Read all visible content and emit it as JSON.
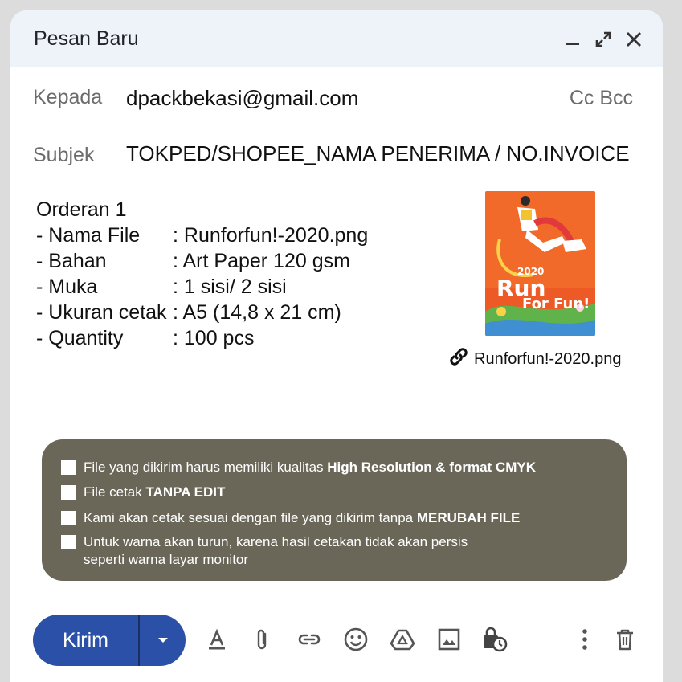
{
  "window": {
    "title": "Pesan Baru"
  },
  "to": {
    "label": "Kepada",
    "value": "dpackbekasi@gmail.com",
    "cc_bcc": "Cc Bcc"
  },
  "subject": {
    "label": "Subjek",
    "value": "TOKPED/SHOPEE_NAMA PENERIMA / NO.INVOICE"
  },
  "body": {
    "heading": "Orderan 1",
    "rows": [
      {
        "label": "- Nama File",
        "value": ": Runforfun!-2020.png"
      },
      {
        "label": "- Bahan",
        "value": ": Art Paper 120 gsm"
      },
      {
        "label": "- Muka",
        "value": ": 1 sisi/ 2 sisi"
      },
      {
        "label": "- Ukuran cetak",
        "value": ": A5 (14,8 x 21 cm)"
      },
      {
        "label": "- Quantity",
        "value": ": 100 pcs"
      }
    ]
  },
  "attachment": {
    "filename": "Runforfun!-2020.png",
    "thumb_year": "2020",
    "thumb_title_1": "Run",
    "thumb_title_2": "For Fun!"
  },
  "notice": {
    "items": [
      {
        "text": "File yang dikirim harus memiliki kualitas ",
        "bold": "High Resolution & format CMYK"
      },
      {
        "text": "File cetak ",
        "bold": "TANPA EDIT"
      },
      {
        "text": "Kami akan cetak sesuai dengan file yang dikirim tanpa ",
        "bold": "MERUBAH FILE"
      },
      {
        "text": "Untuk warna akan turun, karena hasil cetakan tidak akan persis",
        "line2": "seperti warna layar monitor"
      }
    ]
  },
  "toolbar": {
    "send_label": "Kirim",
    "icons": [
      "format-text-icon",
      "attach-icon",
      "link-icon",
      "emoji-icon",
      "drive-icon",
      "image-icon",
      "confidential-icon",
      "more-icon",
      "trash-icon"
    ]
  },
  "colors": {
    "send": "#2a50a7",
    "notice_bg": "#6a6759",
    "titlebar": "#eef2f9"
  }
}
